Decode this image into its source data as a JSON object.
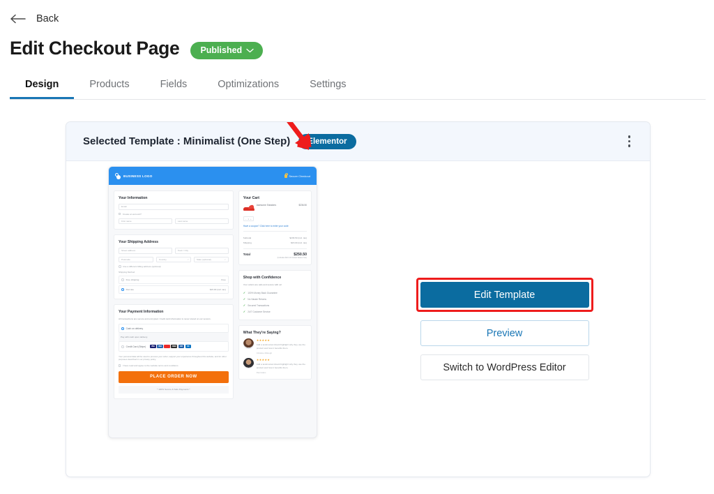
{
  "topbar": {
    "back_label": "Back",
    "back_icon": "arrow-left-icon"
  },
  "header": {
    "title": "Edit Checkout Page",
    "status": {
      "label": "Published",
      "color": "#4caf50",
      "chevron": "chevron-down-icon"
    }
  },
  "tabs": [
    {
      "label": "Design",
      "active": true
    },
    {
      "label": "Products",
      "active": false
    },
    {
      "label": "Fields",
      "active": false
    },
    {
      "label": "Optimizations",
      "active": false
    },
    {
      "label": "Settings",
      "active": false
    }
  ],
  "card": {
    "head_text": "Selected Template :  Minimalist  (One Step)",
    "builder_badge": "Elementor",
    "menu_icon": "kebab-menu-icon"
  },
  "actions": {
    "edit_template": "Edit Template",
    "preview": "Preview",
    "switch_editor": "Switch to WordPress Editor",
    "highlight_color": "#ee1c1c",
    "primary_color": "#0b6ca0"
  },
  "preview": {
    "header": {
      "logo": "BUSINESS LOGO",
      "secure": "Secure Checkout",
      "lock_icon": "lock-icon",
      "bar_color": "#2b90ef"
    },
    "information": {
      "heading": "Your Information",
      "email_placeholder": "Email",
      "create_account": "Create an account?",
      "first_name_placeholder": "First name",
      "last_name_placeholder": "Last name"
    },
    "shipping": {
      "heading": "Your Shipping Address",
      "street_placeholder": "Street address",
      "town_placeholder": "Town / City",
      "postcode_placeholder": "Postcode",
      "country_placeholder": "Country",
      "state_placeholder": "State (optional)",
      "billing_checkbox": "Use a different billing address (optional)",
      "method_label": "Shipping Method",
      "methods": [
        {
          "label": "Free shipping",
          "price": "Free",
          "selected": false
        },
        {
          "label": "Flat rate",
          "price": "$15.00 (incl. tax)",
          "selected": true
        }
      ]
    },
    "payment": {
      "heading": "Your Payment Information",
      "subtitle": "All transactions are secure and encrypted. Credit card information is never stored on our servers.",
      "cod_label": "Cash on delivery",
      "cod_note": "Pay with cash upon delivery.",
      "card_label": "Credit Card (Stripe)",
      "card_brands": [
        "VISA",
        "VISA",
        "MC",
        "AMEX",
        "JCB",
        "DC"
      ],
      "privacy_text": "Your personal data will be used to process your order, support your experience throughout this website, and for other purposes described in our privacy policy.",
      "privacy_link": "privacy policy",
      "terms_text": "I have read and agree to the website terms and conditions",
      "terms_link": "terms and conditions",
      "order_button": "PLACE ORDER NOW",
      "footnote": "* 100% Secure & Safe Payments *"
    },
    "cart": {
      "heading": "Your Cart",
      "item_name": "Awesome Sneakers",
      "item_price": "$236.50",
      "item_tax": "(incl. tax)",
      "quantity": "1",
      "coupon": "Have a coupon? Click here to enter your code",
      "subtotal_label": "Subtotal",
      "subtotal_value": "$236.50 (incl. tax)",
      "shipping_label": "Shipping",
      "shipping_value": "$15.00 (incl. tax)",
      "total_label": "Total",
      "total_value": "$250.50",
      "total_note": "(includes $24.10 United States Tax)"
    },
    "trust": {
      "heading": "Shop with Confidence",
      "subtitle": "Your orders are safe and secure with us!",
      "items": [
        "100% Money Back Guarantee",
        "No Hassle Returns",
        "Secured Transactions",
        "24/7 Customer Service"
      ]
    },
    "testimonials": {
      "heading": "What They're Saying?",
      "items": [
        {
          "stars": "★★★★★",
          "text": "Add a testimonial should highlight why they use the product and how it benefits them.",
          "name": "Christine McHugh"
        },
        {
          "stars": "★★★★★",
          "text": "Add a testimonial should highlight why they use the product and how it benefits them.",
          "name": "Paul Adam"
        }
      ]
    }
  }
}
